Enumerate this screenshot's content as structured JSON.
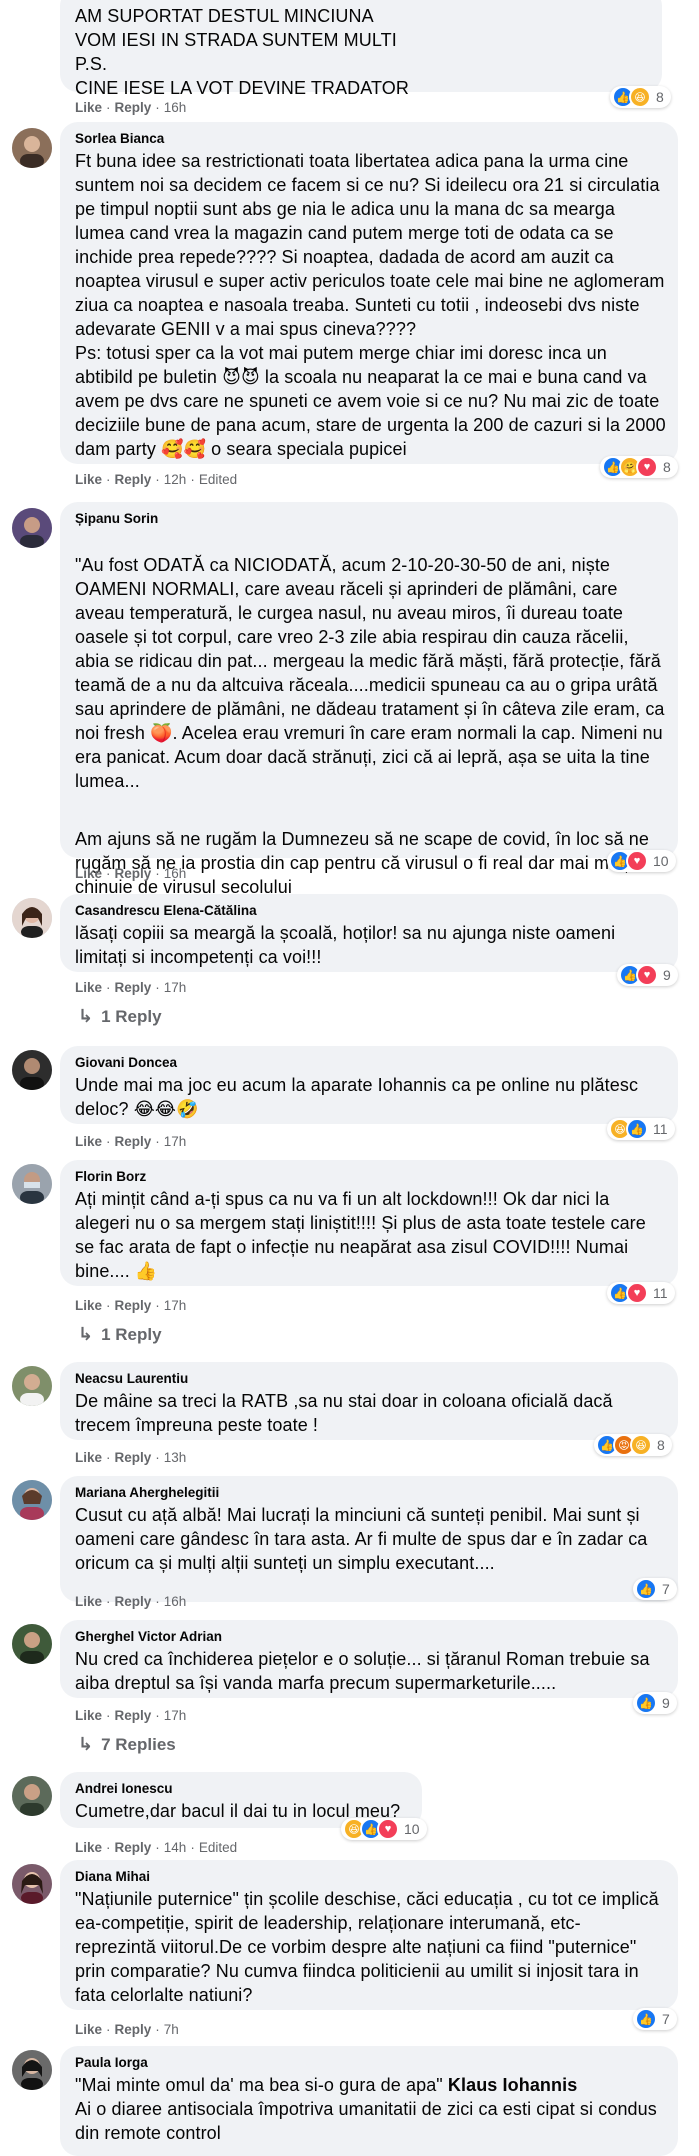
{
  "comments": [
    {
      "author": "",
      "text": "AM SUPORTAT DESTUL MINCIUNA\nVOM IESI IN STRADA SUNTEM MULTI\nP.S.\nCINE IESE LA VOT DEVINE TRADATOR",
      "like": "Like",
      "reply": "Reply",
      "time": "16h",
      "edited": "",
      "reactions": [
        "like",
        "haha"
      ],
      "reaction_count": "8"
    },
    {
      "author": "Sorlea Bianca",
      "text": "Ft buna idee sa restrictionati toata libertatea adica pana la urma cine suntem noi sa decidem ce facem si ce nu? Si ideilecu ora 21 si circulatia pe timpul noptii sunt abs ge nia le adica unu la mana dc sa mearga lumea cand vrea la magazin cand putem merge toti de odata ca se inchide prea repede???? Si noaptea, dadada de acord am auzit ca noaptea virusul e super activ periculos toate cele mai bine ne aglomeram ziua ca noaptea e nasoala treaba. Sunteti cu totii , indeosebi dvs niste adevarate GENII v a mai spus cineva????\nPs: totusi sper ca la vot mai putem merge chiar imi doresc inca un abtibild pe buletin 😈😈 la scoala nu neaparat la ce mai e buna cand va avem pe dvs care ne spuneti ce avem voie si ce nu? Nu mai zic de toate deciziile bune de pana acum, stare de urgenta la 200 de cazuri si la 2000 dam party 🥰🥰 o seara speciala pupicei",
      "like": "Like",
      "reply": "Reply",
      "time": "12h",
      "edited": "Edited",
      "reactions": [
        "like",
        "care",
        "love"
      ],
      "reaction_count": "8"
    },
    {
      "author": "Șipanu Sorin",
      "paragraphs": [
        "\"Au fost ODATĂ ca NICIODATĂ, acum 2-10-20-30-50 de ani, niște OAMENI NORMALI, care aveau răceli și aprinderi de plămâni, care aveau temperatură, le curgea nasul, nu aveau miros, îi dureau toate oasele și tot corpul, care vreo 2-3 zile abia respirau din cauza răcelii, abia se ridicau din pat... mergeau la medic fără măști, fără protecție, fără teamă de a nu da altcuiva răceala....medicii spuneau ca au o gripa urâtă sau aprindere de plămâni, ne dădeau tratament și în câteva zile eram, ca noi fresh 🍑. Acelea erau vremuri în care eram normali la cap. Nimeni nu era panicat. Acum doar dacă strănuți, zici că ai lepră, așa se uita la tine lumea...",
        "Am ajuns să ne rugăm la Dumnezeu să ne scape de covid, în loc să ne rugăm să ne ia prostia din cap pentru că virusul o fi real dar mai mulți se chinuie de virusul secolului"
      ],
      "like": "Like",
      "reply": "Reply",
      "time": "16h",
      "edited": "",
      "reactions": [
        "like",
        "love"
      ],
      "reaction_count": "10"
    },
    {
      "author": "Casandrescu Elena-Cătălina",
      "text": "lăsați copiii sa meargă la școală, hoților! sa nu ajunga niste oameni limitați si incompetenți ca voi!!!",
      "like": "Like",
      "reply": "Reply",
      "time": "17h",
      "edited": "",
      "reactions": [
        "like",
        "love"
      ],
      "reaction_count": "9",
      "replies": "1 Reply"
    },
    {
      "author": "Giovani Doncea",
      "text": "Unde mai ma joc eu acum la aparate Iohannis ca pe online nu plătesc deloc? 😂😂🤣",
      "like": "Like",
      "reply": "Reply",
      "time": "17h",
      "edited": "",
      "reactions": [
        "haha",
        "like"
      ],
      "reaction_count": "11"
    },
    {
      "author": "Florin Borz",
      "text": "Ați mințit când a-ți spus ca nu va fi un alt lockdown!!! Ok dar nici la alegeri nu o sa mergem stați liniștit!!!! Și plus de asta toate testele care se fac arata de fapt o infecție nu neapărat asa zisul COVID!!!! Numai bine.... 👍",
      "like": "Like",
      "reply": "Reply",
      "time": "17h",
      "edited": "",
      "reactions": [
        "like",
        "love"
      ],
      "reaction_count": "11",
      "replies": "1 Reply"
    },
    {
      "author": "Neacsu Laurentiu",
      "text": "De mâine sa treci la RATB ,sa nu stai doar in coloana oficială dacă trecem împreuna peste toate !",
      "like": "Like",
      "reply": "Reply",
      "time": "13h",
      "edited": "",
      "reactions": [
        "like",
        "angry",
        "haha"
      ],
      "reaction_count": "8"
    },
    {
      "author": "Mariana Aherghelegitii",
      "text": "Cusut cu ață albă! Mai lucrați la minciuni că sunteți penibil. Mai sunt și oameni care gândesc în tara asta. Ar fi multe de spus dar e în zadar ca oricum ca și mulți alții sunteți un simplu executant....",
      "like": "Like",
      "reply": "Reply",
      "time": "16h",
      "edited": "",
      "reactions": [
        "like"
      ],
      "reaction_count": "7"
    },
    {
      "author": "Gherghel Victor Adrian",
      "text": "Nu cred ca închiderea piețelor e o soluție... si țăranul Roman trebuie sa aiba dreptul sa își vanda marfa precum supermarketurile.....",
      "like": "Like",
      "reply": "Reply",
      "time": "17h",
      "edited": "",
      "reactions": [
        "like"
      ],
      "reaction_count": "9",
      "replies": "7 Replies"
    },
    {
      "author": "Andrei Ionescu",
      "text": "Cumetre,dar bacul il dai tu in locul meu?",
      "like": "Like",
      "reply": "Reply",
      "time": "14h",
      "edited": "Edited",
      "reactions": [
        "haha",
        "like",
        "love"
      ],
      "reaction_count": "10"
    },
    {
      "author": "Diana Mihai",
      "text": "\"Națiunile puternice\" țin școlile deschise, căci educația , cu tot ce implică ea-competiție, spirit de leadership, relaționare interumană, etc- reprezintă viitorul.De ce vorbim despre alte națiuni ca fiind \"puternice\" prin comparatie? Nu cumva fiindca politicienii au umilit si injosit tara in fata celorlalte natiuni?",
      "like": "Like",
      "reply": "Reply",
      "time": "7h",
      "edited": "",
      "reactions": [
        "like"
      ],
      "reaction_count": "7"
    },
    {
      "author": "Paula Iorga",
      "text_before": "\"Mai minte omul da' ma bea si-o gura de apa\" ",
      "tag": "Klaus Iohannis",
      "text_after": "\nAi o diaree antisociala împotriva umanitatii de zici ca esti cipat si condus din remote control"
    }
  ],
  "icons": {
    "like": "thumbs-up-icon",
    "love": "heart-icon",
    "haha": "laugh-emoji-icon",
    "angry": "angry-emoji-icon",
    "care": "care-emoji-icon",
    "reply_arrow": "reply-arrow-icon"
  },
  "colors": {
    "like": "#1877f2",
    "love": "#f33e58",
    "haha": "#f7b125",
    "angry": "#e9710f",
    "bubble": "#f0f2f5",
    "meta": "#65676b"
  }
}
